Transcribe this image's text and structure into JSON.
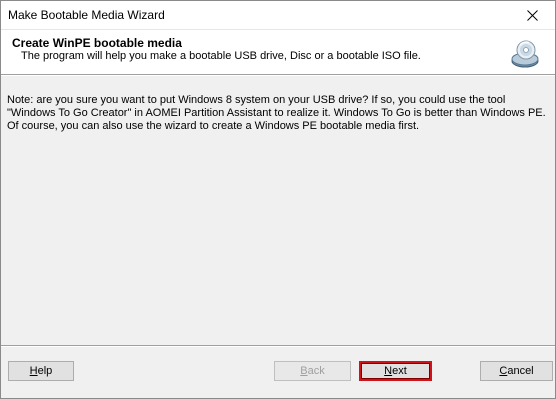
{
  "window": {
    "title": "Make Bootable Media Wizard"
  },
  "header": {
    "title": "Create WinPE bootable media",
    "description": "The program will help you make a bootable USB drive, Disc or a bootable ISO file.",
    "icon": "disc-icon"
  },
  "note": {
    "text": "Note: are you sure you want to put Windows 8 system on your USB drive? If so, you could use the tool \"Windows To Go Creator\" in AOMEI Partition Assistant to realize it. Windows To Go is better than Windows PE. Of course, you can also use the wizard to create a Windows PE bootable media first."
  },
  "buttons": {
    "help": {
      "first": "H",
      "rest": "elp"
    },
    "back": {
      "first": "B",
      "rest": "ack",
      "enabled": false
    },
    "next": {
      "first": "N",
      "rest": "ext",
      "highlight_color": "#d0121b"
    },
    "cancel": {
      "first": "C",
      "rest": "ancel"
    }
  }
}
